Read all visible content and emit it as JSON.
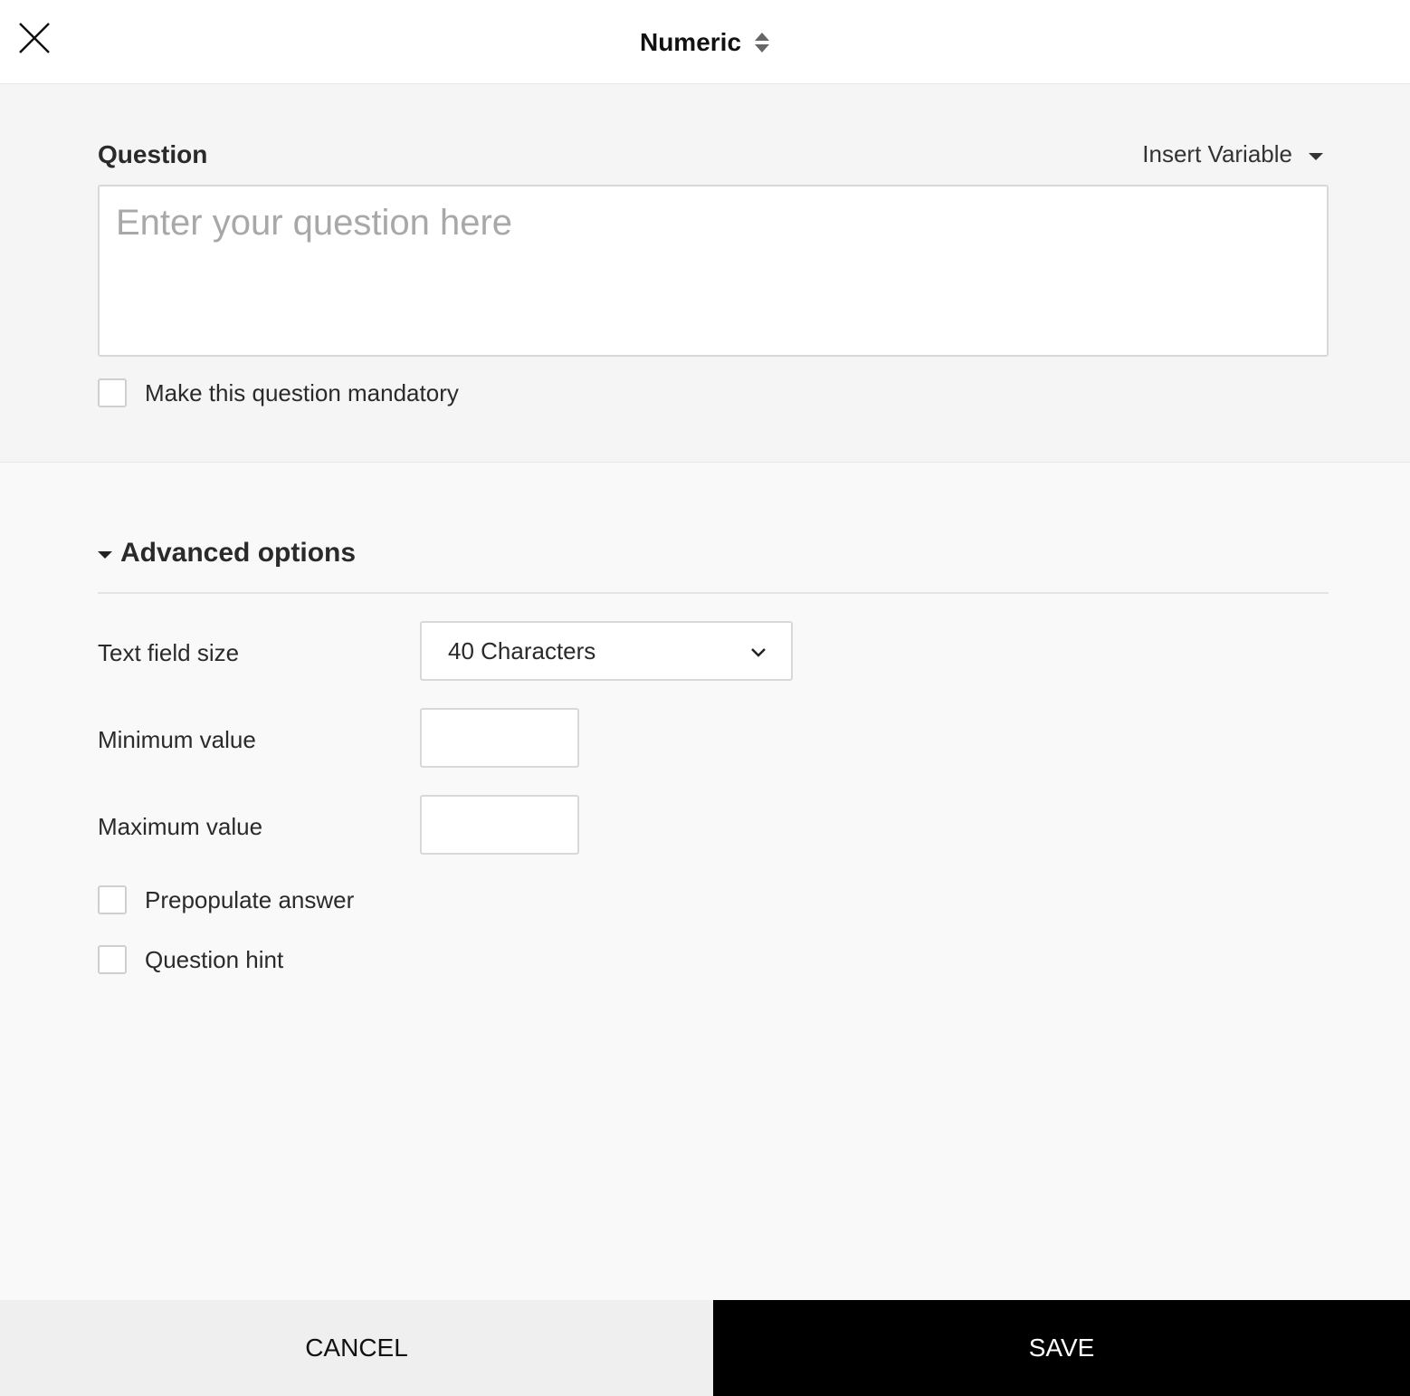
{
  "header": {
    "title": "Numeric",
    "close_icon": "close-icon",
    "type_selector_icon": "sort-arrows-icon"
  },
  "question": {
    "label": "Question",
    "insert_variable_label": "Insert Variable",
    "textarea_value": "",
    "textarea_placeholder": "Enter your question here",
    "mandatory_label": "Make this question mandatory",
    "mandatory_checked": false
  },
  "advanced": {
    "title": "Advanced options",
    "expanded": true,
    "text_field_size": {
      "label": "Text field size",
      "selected": "40 Characters"
    },
    "minimum_value": {
      "label": "Minimum value",
      "value": ""
    },
    "maximum_value": {
      "label": "Maximum value",
      "value": ""
    },
    "prepopulate": {
      "label": "Prepopulate answer",
      "checked": false
    },
    "question_hint": {
      "label": "Question hint",
      "checked": false
    }
  },
  "footer": {
    "cancel_label": "CANCEL",
    "save_label": "SAVE"
  },
  "colors": {
    "save_bg": "#000000",
    "cancel_bg": "#efefef",
    "question_section_bg": "#f5f5f5"
  }
}
